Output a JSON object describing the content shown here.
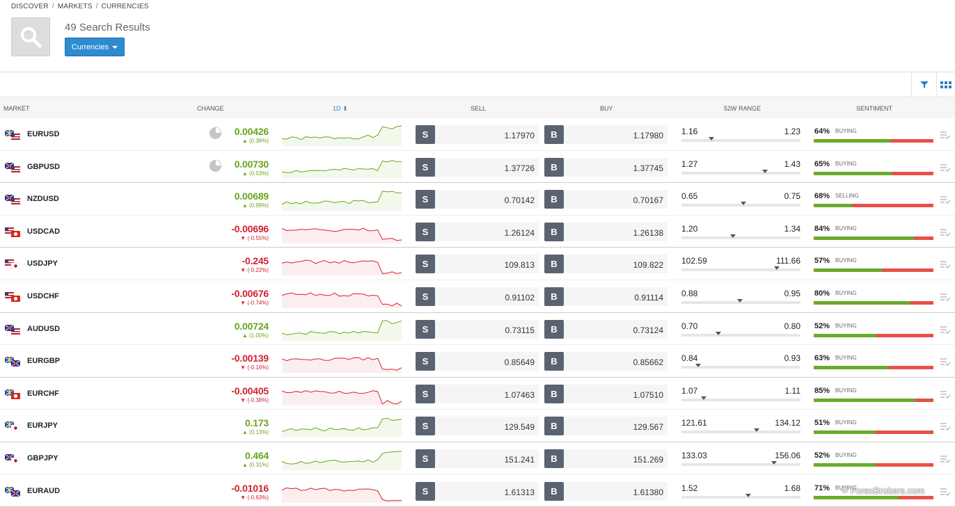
{
  "breadcrumb": [
    "DISCOVER",
    "MARKETS",
    "CURRENCIES"
  ],
  "results_text": "49 Search Results",
  "category_button": "Currencies",
  "headers": {
    "market": "MARKET",
    "change": "CHANGE",
    "period": "1D",
    "sell": "SELL",
    "buy": "BUY",
    "range": "52W RANGE",
    "sentiment": "SENTIMENT"
  },
  "trade_labels": {
    "sell": "S",
    "buy": "B"
  },
  "colors": {
    "positive": "#6aa41d",
    "negative": "#d3212f",
    "accent": "#2e8bd0"
  },
  "rows": [
    {
      "symbol": "EURUSD",
      "change": "0.00426",
      "pct": "(0.36%)",
      "dir": "up",
      "sell": "1.17970",
      "buy": "1.17980",
      "low": "1.16",
      "high": "1.23",
      "pos": 0.25,
      "sentiment": "64%",
      "label": "BUYING",
      "share": 0.64,
      "pie": true,
      "flags": [
        "eu",
        "us"
      ]
    },
    {
      "symbol": "GBPUSD",
      "change": "0.00730",
      "pct": "(0.53%)",
      "dir": "up",
      "sell": "1.37726",
      "buy": "1.37745",
      "low": "1.27",
      "high": "1.43",
      "pos": 0.7,
      "sentiment": "65%",
      "label": "BUYING",
      "share": 0.65,
      "pie": true,
      "flags": [
        "uk",
        "us"
      ]
    },
    {
      "symbol": "NZDUSD",
      "change": "0.00689",
      "pct": "(0.99%)",
      "dir": "up",
      "sell": "0.70142",
      "buy": "0.70167",
      "low": "0.65",
      "high": "0.75",
      "pos": 0.52,
      "sentiment": "68%",
      "label": "SELLING",
      "share": 0.32,
      "pie": false,
      "flags": [
        "nz",
        "us"
      ]
    },
    {
      "symbol": "USDCAD",
      "change": "-0.00696",
      "pct": "(-0.55%)",
      "dir": "down",
      "sell": "1.26124",
      "buy": "1.26138",
      "low": "1.20",
      "high": "1.34",
      "pos": 0.43,
      "sentiment": "84%",
      "label": "BUYING",
      "share": 0.84,
      "pie": false,
      "flags": [
        "us",
        "ca"
      ]
    },
    {
      "symbol": "USDJPY",
      "change": "-0.245",
      "pct": "(-0.22%)",
      "dir": "down",
      "sell": "109.813",
      "buy": "109.822",
      "low": "102.59",
      "high": "111.66",
      "pos": 0.8,
      "sentiment": "57%",
      "label": "BUYING",
      "share": 0.57,
      "pie": false,
      "flags": [
        "us",
        "jp"
      ]
    },
    {
      "symbol": "USDCHF",
      "change": "-0.00676",
      "pct": "(-0.74%)",
      "dir": "down",
      "sell": "0.91102",
      "buy": "0.91114",
      "low": "0.88",
      "high": "0.95",
      "pos": 0.49,
      "sentiment": "80%",
      "label": "BUYING",
      "share": 0.8,
      "pie": false,
      "flags": [
        "us",
        "ch"
      ]
    },
    {
      "symbol": "AUDUSD",
      "change": "0.00724",
      "pct": "(1.00%)",
      "dir": "up",
      "sell": "0.73115",
      "buy": "0.73124",
      "low": "0.70",
      "high": "0.80",
      "pos": 0.31,
      "sentiment": "52%",
      "label": "BUYING",
      "share": 0.52,
      "pie": false,
      "flags": [
        "au",
        "us"
      ]
    },
    {
      "symbol": "EURGBP",
      "change": "-0.00139",
      "pct": "(-0.16%)",
      "dir": "down",
      "sell": "0.85649",
      "buy": "0.85662",
      "low": "0.84",
      "high": "0.93",
      "pos": 0.14,
      "sentiment": "63%",
      "label": "BUYING",
      "share": 0.63,
      "pie": false,
      "flags": [
        "eu",
        "uk"
      ]
    },
    {
      "symbol": "EURCHF",
      "change": "-0.00405",
      "pct": "(-0.38%)",
      "dir": "down",
      "sell": "1.07463",
      "buy": "1.07510",
      "low": "1.07",
      "high": "1.11",
      "pos": 0.19,
      "sentiment": "85%",
      "label": "BUYING",
      "share": 0.85,
      "pie": false,
      "flags": [
        "eu",
        "ch"
      ]
    },
    {
      "symbol": "EURJPY",
      "change": "0.173",
      "pct": "(0.13%)",
      "dir": "up",
      "sell": "129.549",
      "buy": "129.567",
      "low": "121.61",
      "high": "134.12",
      "pos": 0.63,
      "sentiment": "51%",
      "label": "BUYING",
      "share": 0.51,
      "pie": false,
      "flags": [
        "eu",
        "jp"
      ]
    },
    {
      "symbol": "GBPJPY",
      "change": "0.464",
      "pct": "(0.31%)",
      "dir": "up",
      "sell": "151.241",
      "buy": "151.269",
      "low": "133.03",
      "high": "156.06",
      "pos": 0.78,
      "sentiment": "52%",
      "label": "BUYING",
      "share": 0.52,
      "pie": false,
      "flags": [
        "uk",
        "jp"
      ]
    },
    {
      "symbol": "EURAUD",
      "change": "-0.01016",
      "pct": "(-0.63%)",
      "dir": "down",
      "sell": "1.61313",
      "buy": "1.61380",
      "low": "1.52",
      "high": "1.68",
      "pos": 0.56,
      "sentiment": "71%",
      "label": "BUYING",
      "share": 0.71,
      "pie": false,
      "flags": [
        "eu",
        "au"
      ]
    }
  ],
  "watermark": "ForexBrokers.com"
}
